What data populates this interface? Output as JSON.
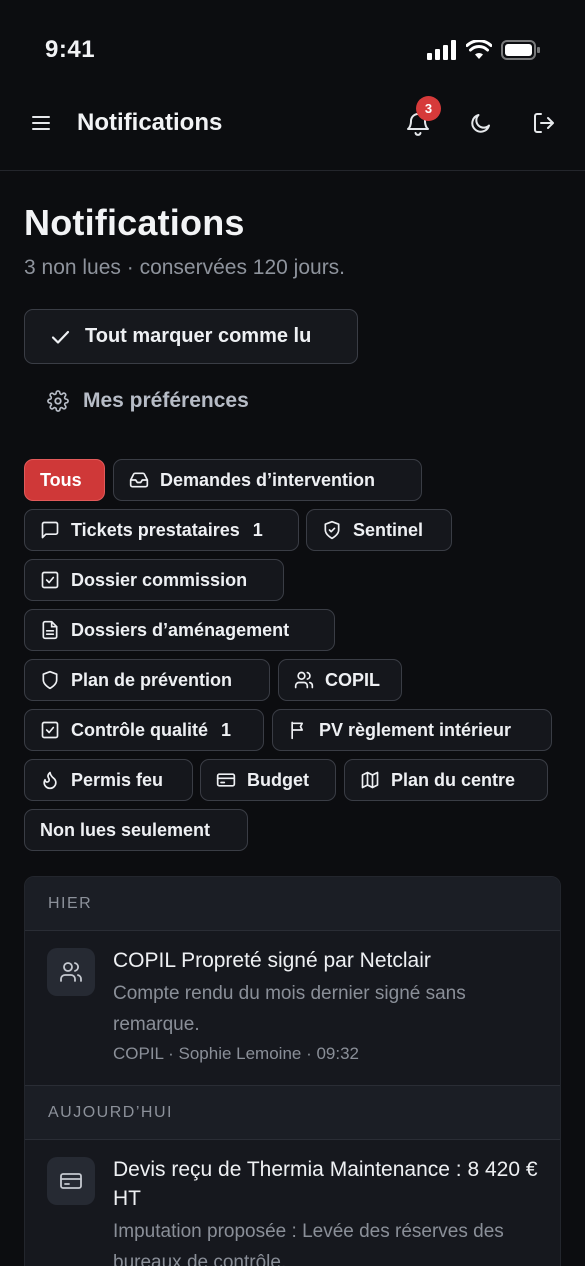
{
  "status_bar": {
    "time": "9:41"
  },
  "header": {
    "title": "Notifications",
    "badge_count": "3",
    "icons": [
      "menu-icon",
      "bell-icon",
      "moon-icon",
      "logout-icon"
    ]
  },
  "page": {
    "title": "Notifications",
    "subtitle": "3 non lues · conservées 120 jours.",
    "mark_all_label": "Tout marquer comme lu",
    "preferences_label": "Mes préférences"
  },
  "filters": [
    {
      "label": "Tous",
      "icon": "",
      "active": true
    },
    {
      "label": "Demandes d’intervention",
      "icon": "inbox-icon"
    },
    {
      "label": "Tickets prestataires",
      "icon": "message-icon",
      "count": "1"
    },
    {
      "label": "Sentinel",
      "icon": "shield-check-icon"
    },
    {
      "label": "Dossier commission",
      "icon": "checkbox-icon"
    },
    {
      "label": "Dossiers d’aménagement",
      "icon": "document-icon"
    },
    {
      "label": "Plan de prévention",
      "icon": "shield-icon"
    },
    {
      "label": "COPIL",
      "icon": "users-icon"
    },
    {
      "label": "Contrôle qualité",
      "icon": "checkbox-icon",
      "count": "1"
    },
    {
      "label": "PV règlement intérieur",
      "icon": "flag-icon"
    },
    {
      "label": "Permis feu",
      "icon": "flame-icon"
    },
    {
      "label": "Budget",
      "icon": "wallet-icon"
    },
    {
      "label": "Plan du centre",
      "icon": "map-icon"
    },
    {
      "label": "Non lues seulement",
      "icon": ""
    }
  ],
  "sections": [
    {
      "label": "HIER",
      "items": [
        {
          "icon": "users-icon",
          "title": "COPIL Propreté signé par Netclair",
          "body": "Compte rendu du mois dernier signé sans remarque.",
          "meta": "COPIL · Sophie Lemoine · 09:32"
        }
      ]
    },
    {
      "label": "AUJOURD’HUI",
      "items": [
        {
          "icon": "wallet-icon",
          "title": "Devis reçu de Thermia Maintenance : 8 420 € HT",
          "body": "Imputation proposée : Levée des réserves des bureaux de contrôle."
        }
      ]
    }
  ]
}
